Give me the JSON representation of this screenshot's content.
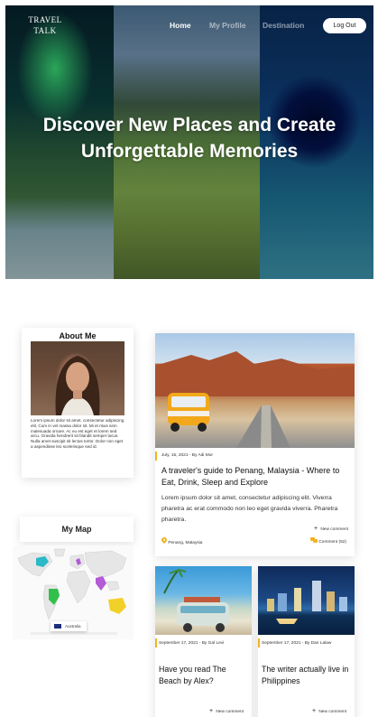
{
  "brand": {
    "line1": "TRAVEL",
    "line2": "TALK"
  },
  "nav": {
    "items": [
      {
        "label": "Home",
        "active": true
      },
      {
        "label": "My Profile",
        "active": false
      },
      {
        "label": "Destination",
        "active": false
      }
    ],
    "logout_label": "Log Out"
  },
  "hero": {
    "title_line1": "Discover New Places and Create",
    "title_line2": "Unforgettable Memories"
  },
  "about": {
    "title": "About Me",
    "text": "Lorem ipsum dolor sit amet, consectetur adipiscing elit. Cum in vel massa dolor sit. Mi et risus sem malesuada ornare. Ac eu est eget et lorem sed arcu. Gravida hendrerit sit blandit semper lacus. Nulla amet suscipit sit lectus tortor. Dolor non eget a aspendisse leo scelerisque sed id."
  },
  "map": {
    "title": "My Map",
    "tooltip": "Australia"
  },
  "posts": {
    "main": {
      "meta": "July, 15, 2021 - By Adi Mor",
      "title": "A traveler's guide to Penang, Malaysia - Where to Eat, Drink, Sleep and Explore",
      "excerpt": "Lorem ipsum dolor sit amet, consectetur adipiscing elit. Viverra pharetra ac erat commodo non leo eget gravida viverra. Pharetra pharetra.",
      "new_comment": "New comment",
      "location": "Penang, Malaysia",
      "comments": "Comment (52)"
    },
    "second": {
      "meta": "September 17, 2021 - By Gal Levi",
      "title": "Have you read The Beach by Alex?",
      "new_comment": "New comment"
    },
    "third": {
      "meta": "September 17, 2021 - By Dan Lalaw",
      "title": "The writer actually live in Philippines",
      "new_comment": "New comment"
    }
  },
  "colors": {
    "accent": "#f0b323",
    "map_teal": "#2bb8c7",
    "map_green": "#33c04a",
    "map_purple": "#b45bd6",
    "map_yellow": "#f2d02a"
  }
}
